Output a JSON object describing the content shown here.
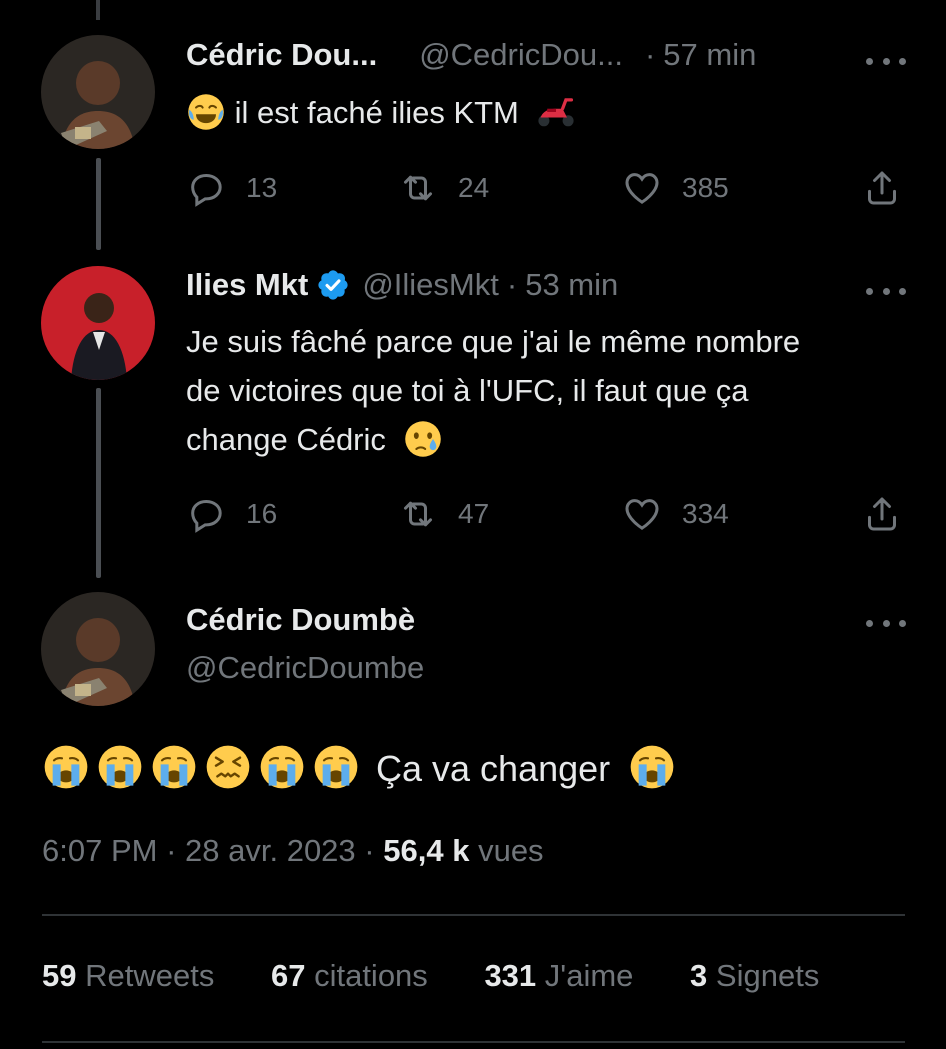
{
  "tweets": [
    {
      "name": "Cédric Dou...",
      "handle": "@CedricDou...",
      "separator": "·",
      "time": "57 min",
      "text": "il est faché ilies KTM",
      "emojis": [
        "laughing-crying-emoji",
        "scooter-emoji"
      ],
      "replies": "13",
      "retweets": "24",
      "likes": "385"
    },
    {
      "name": "Ilies Mkt",
      "handle": "@IliesMkt",
      "separator": "·",
      "time": "53 min",
      "text_lines": [
        "Je suis fâché parce que j'ai le même nombre",
        "de victoires que toi à l'UFC, il faut que ça",
        "change Cédric"
      ],
      "emojis": [
        "teary-emoji"
      ],
      "replies": "16",
      "retweets": "47",
      "likes": "334"
    }
  ],
  "main_tweet": {
    "name": "Cédric Doumbè",
    "handle": "@CedricDoumbe",
    "text": "Ça va changer",
    "emojis": [
      "crying-emoji",
      "crying-emoji",
      "crying-emoji",
      "confounded-emoji",
      "crying-emoji",
      "crying-emoji",
      "crying-emoji"
    ],
    "time": "6:07 PM",
    "date": "28 avr. 2023",
    "dot": "·",
    "views_count": "56,4 k",
    "views_label": "vues"
  },
  "stats": {
    "retweets": {
      "count": "59",
      "label": "Retweets"
    },
    "quotes": {
      "count": "67",
      "label": "citations"
    },
    "likes": {
      "count": "331",
      "label": "J'aime"
    },
    "bookmarks": {
      "count": "3",
      "label": "Signets"
    }
  },
  "colors": {
    "background": "#000000",
    "text": "#e7e9ea",
    "muted": "#71767b",
    "verified": "#1d9bf0",
    "divider": "#2f3336"
  }
}
